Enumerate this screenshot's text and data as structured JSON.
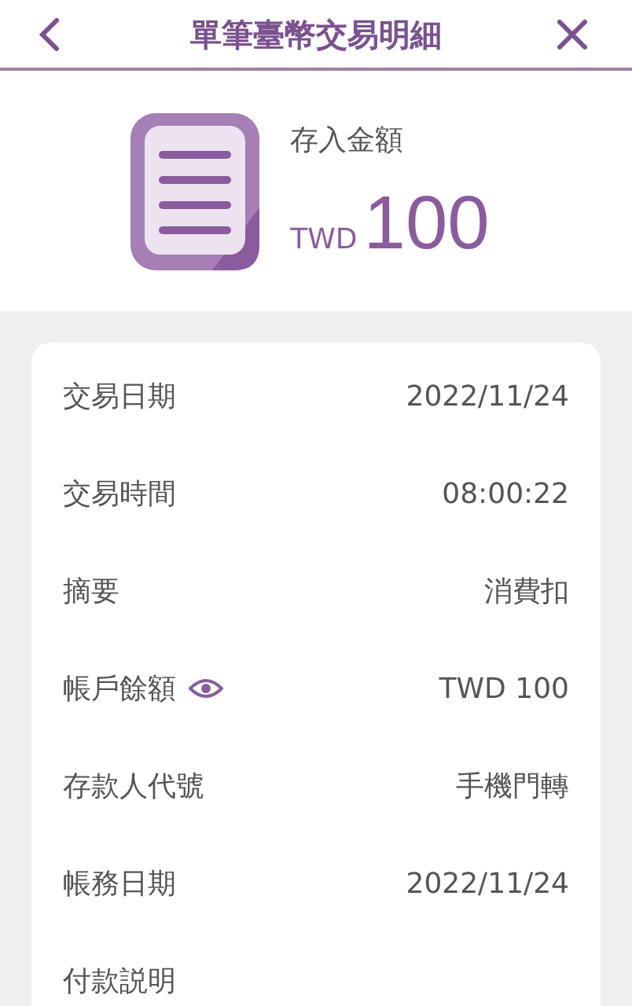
{
  "header": {
    "title": "單筆臺幣交易明細"
  },
  "summary": {
    "label": "存入金額",
    "currency": "TWD",
    "amount": "100"
  },
  "rows": [
    {
      "label": "交易日期",
      "value": "2022/11/24",
      "eye": false
    },
    {
      "label": "交易時間",
      "value": "08:00:22",
      "eye": false
    },
    {
      "label": "摘要",
      "value": "消費扣",
      "eye": false
    },
    {
      "label": "帳戶餘額",
      "value": "TWD 100",
      "eye": true
    },
    {
      "label": "存款人代號",
      "value": "手機門轉",
      "eye": false
    },
    {
      "label": "帳務日期",
      "value": "2022/11/24",
      "eye": false
    },
    {
      "label": "付款説明",
      "eye": false
    }
  ]
}
